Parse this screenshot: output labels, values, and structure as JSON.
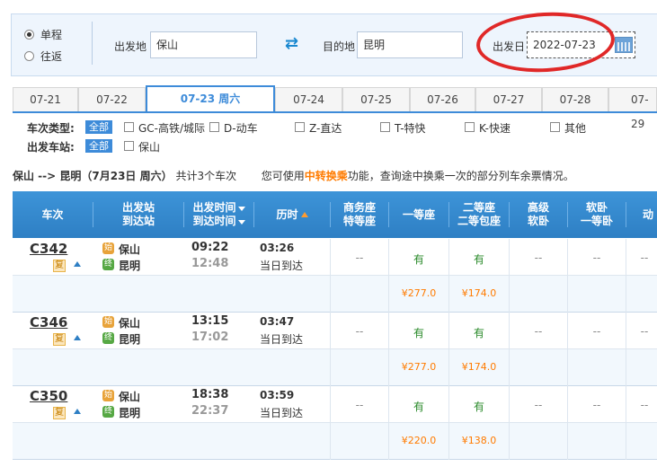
{
  "search": {
    "trip_types": [
      {
        "label": "单程",
        "selected": true
      },
      {
        "label": "往返",
        "selected": false
      }
    ],
    "from_label": "出发地",
    "from_value": "保山",
    "to_label": "目的地",
    "to_value": "昆明",
    "date_label": "出发日",
    "date_value": "2022-07-23"
  },
  "date_tabs": [
    {
      "label": "07-21",
      "active": false
    },
    {
      "label": "07-22",
      "active": false
    },
    {
      "label": "07-23 周六",
      "active": true
    },
    {
      "label": "07-24",
      "active": false
    },
    {
      "label": "07-25",
      "active": false
    },
    {
      "label": "07-26",
      "active": false
    },
    {
      "label": "07-27",
      "active": false
    },
    {
      "label": "07-28",
      "active": false
    },
    {
      "label": "07-29",
      "active": false
    }
  ],
  "filters": {
    "train_type_label": "车次类型:",
    "all_label": "全部",
    "train_types": [
      "GC-高铁/城际",
      "D-动车",
      "Z-直达",
      "T-特快",
      "K-快速",
      "其他"
    ],
    "station_label": "出发车站:",
    "stations": [
      "保山"
    ]
  },
  "summary": {
    "route": "保山 --> 昆明（7月23日  周六）",
    "count": "共计3个车次",
    "hint_before": "您可使用",
    "hint_link": "中转换乘",
    "hint_after": "功能，查询途中换乘一次的部分列车余票情况。"
  },
  "table_headers": {
    "train": "车次",
    "stations": [
      "出发站",
      "到达站"
    ],
    "times": [
      "出发时间",
      "到达时间"
    ],
    "duration": "历时",
    "business": [
      "商务座",
      "特等座"
    ],
    "first": "一等座",
    "second": [
      "二等座",
      "二等包座"
    ],
    "soft_premium": [
      "高级",
      "软卧"
    ],
    "soft_sleeper": [
      "软卧",
      "一等卧"
    ],
    "moving": "动"
  },
  "trains": [
    {
      "code": "C342",
      "fu": "复",
      "from": "保山",
      "to": "昆明",
      "dep": "09:22",
      "arr": "12:48",
      "duration": "03:26",
      "arrive_note": "当日到达",
      "business": "--",
      "first": "有",
      "second": "有",
      "soft_premium": "--",
      "soft_sleeper": "--",
      "moving": "--",
      "first_price": "¥277.0",
      "second_price": "¥174.0"
    },
    {
      "code": "C346",
      "fu": "复",
      "from": "保山",
      "to": "昆明",
      "dep": "13:15",
      "arr": "17:02",
      "duration": "03:47",
      "arrive_note": "当日到达",
      "business": "--",
      "first": "有",
      "second": "有",
      "soft_premium": "--",
      "soft_sleeper": "--",
      "moving": "--",
      "first_price": "¥277.0",
      "second_price": "¥174.0"
    },
    {
      "code": "C350",
      "fu": "复",
      "from": "保山",
      "to": "昆明",
      "dep": "18:38",
      "arr": "22:37",
      "duration": "03:59",
      "arrive_note": "当日到达",
      "business": "--",
      "first": "有",
      "second": "有",
      "soft_premium": "--",
      "soft_sleeper": "--",
      "moving": "--",
      "first_price": "¥220.0",
      "second_price": "¥138.0"
    }
  ],
  "badges": {
    "start": "始",
    "end": "终"
  },
  "colors": {
    "accent": "#3d8bd9",
    "highlight_circle": "#e02828",
    "price": "#ff7b00",
    "available": "#2a8a2a"
  }
}
